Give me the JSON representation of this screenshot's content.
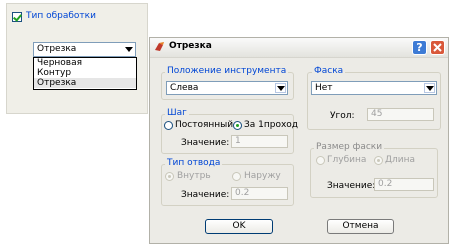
{
  "processing_panel": {
    "checkbox_label": "Тип обработки",
    "combo_value": "Отрезка",
    "dropdown_options": [
      "Черновая",
      "Контур",
      "Отрезка"
    ]
  },
  "dialog": {
    "title": "Отрезка",
    "help_label": "?",
    "tool_position": {
      "title": "Положение инструмента",
      "value": "Слева"
    },
    "step": {
      "title": "Шаг",
      "option_constant": "Постоянный",
      "option_one_pass": "За 1проход",
      "value_label": "Значение:",
      "value": "1"
    },
    "retract_type": {
      "title": "Тип отвода",
      "option_inside": "Внутрь",
      "option_outside": "Наружу",
      "value_label": "Значение:",
      "value": "0.2"
    },
    "chamfer": {
      "title": "Фаска",
      "value": "Нет",
      "angle_label": "Угол:",
      "angle_value": "45"
    },
    "chamfer_size": {
      "title": "Размер фаски",
      "option_depth": "Глубина",
      "option_length": "Длина",
      "value_label": "Значение:",
      "value": "0.2"
    },
    "ok_label": "OK",
    "cancel_label": "Отмена"
  }
}
